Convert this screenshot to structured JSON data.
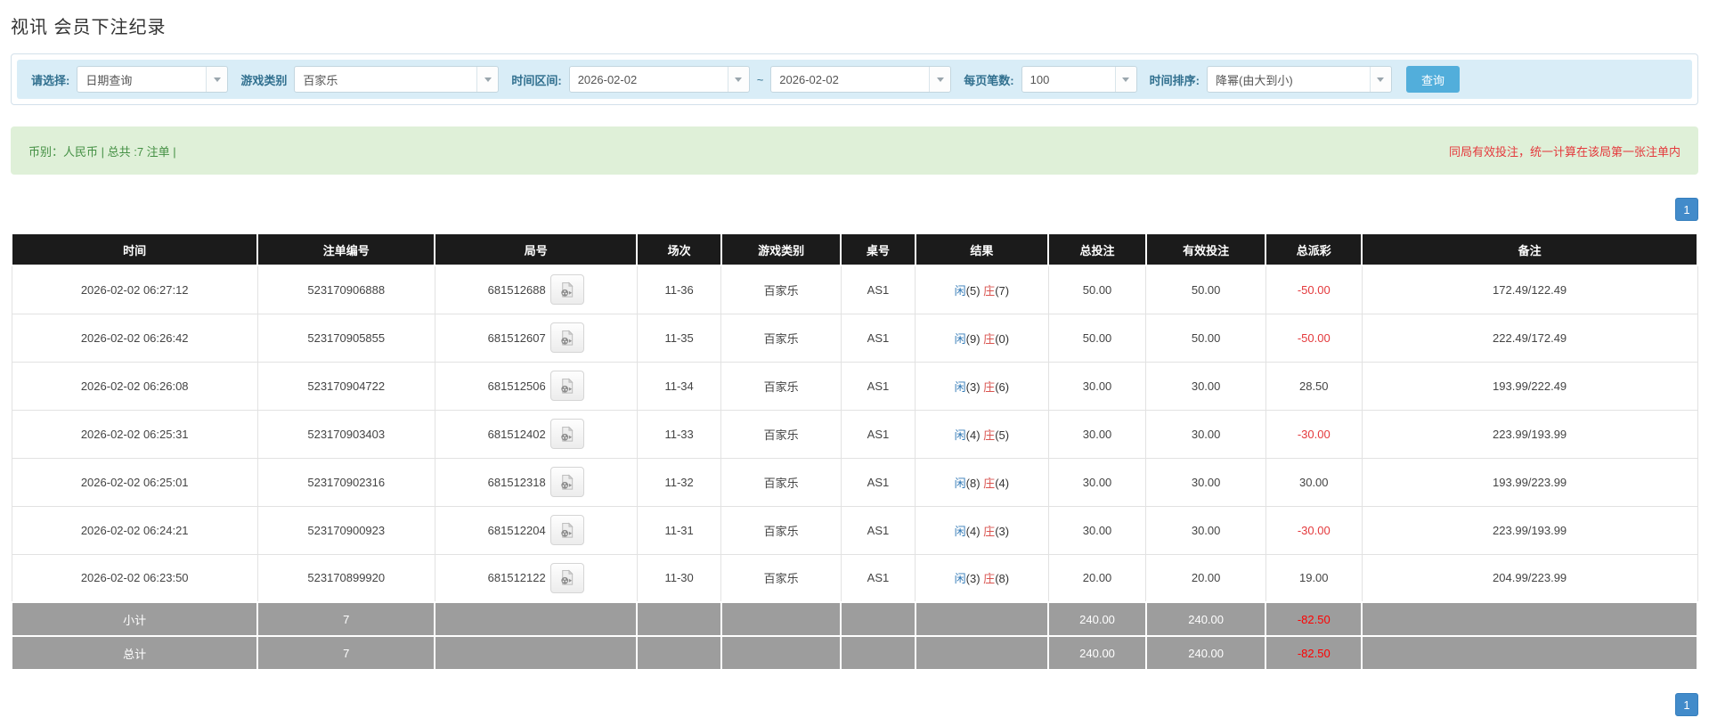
{
  "page": {
    "title": "视讯 会员下注纪录"
  },
  "filters": {
    "select_label": "请选择:",
    "select_value": "日期查询",
    "game_label": "游戏类别",
    "game_value": "百家乐",
    "range_label": "时间区间:",
    "date_from": "2026-02-02",
    "range_separator": "~",
    "date_to": "2026-02-02",
    "per_page_label": "每页笔数:",
    "per_page_value": "100",
    "sort_label": "时间排序:",
    "sort_value": "降幂(由大到小)",
    "query_button": "查询"
  },
  "summary": {
    "left_text": "币别：人民币 | 总共 :7 注单 |",
    "right_notice": "同局有效投注，统一计算在该局第一张注单内"
  },
  "pagination": {
    "page": "1"
  },
  "table": {
    "headers": [
      "时间",
      "注单编号",
      "局号",
      "场次",
      "游戏类别",
      "桌号",
      "结果",
      "总投注",
      "有效投注",
      "总派彩",
      "备注"
    ],
    "rows": [
      {
        "time": "2026-02-02 06:27:12",
        "bet_no": "523170906888",
        "round_no": "681512688",
        "session": "11-36",
        "game": "百家乐",
        "table_no": "AS1",
        "player_label": "闲",
        "player_score": "(5)",
        "banker_label": "庄",
        "banker_score": "(7)",
        "total_bet": "50.00",
        "valid_bet": "50.00",
        "payout": "-50.00",
        "note": "172.49/122.49"
      },
      {
        "time": "2026-02-02 06:26:42",
        "bet_no": "523170905855",
        "round_no": "681512607",
        "session": "11-35",
        "game": "百家乐",
        "table_no": "AS1",
        "player_label": "闲",
        "player_score": "(9)",
        "banker_label": "庄",
        "banker_score": "(0)",
        "total_bet": "50.00",
        "valid_bet": "50.00",
        "payout": "-50.00",
        "note": "222.49/172.49"
      },
      {
        "time": "2026-02-02 06:26:08",
        "bet_no": "523170904722",
        "round_no": "681512506",
        "session": "11-34",
        "game": "百家乐",
        "table_no": "AS1",
        "player_label": "闲",
        "player_score": "(3)",
        "banker_label": "庄",
        "banker_score": "(6)",
        "total_bet": "30.00",
        "valid_bet": "30.00",
        "payout": "28.50",
        "note": "193.99/222.49"
      },
      {
        "time": "2026-02-02 06:25:31",
        "bet_no": "523170903403",
        "round_no": "681512402",
        "session": "11-33",
        "game": "百家乐",
        "table_no": "AS1",
        "player_label": "闲",
        "player_score": "(4)",
        "banker_label": "庄",
        "banker_score": "(5)",
        "total_bet": "30.00",
        "valid_bet": "30.00",
        "payout": "-30.00",
        "note": "223.99/193.99"
      },
      {
        "time": "2026-02-02 06:25:01",
        "bet_no": "523170902316",
        "round_no": "681512318",
        "session": "11-32",
        "game": "百家乐",
        "table_no": "AS1",
        "player_label": "闲",
        "player_score": "(8)",
        "banker_label": "庄",
        "banker_score": "(4)",
        "total_bet": "30.00",
        "valid_bet": "30.00",
        "payout": "30.00",
        "note": "193.99/223.99"
      },
      {
        "time": "2026-02-02 06:24:21",
        "bet_no": "523170900923",
        "round_no": "681512204",
        "session": "11-31",
        "game": "百家乐",
        "table_no": "AS1",
        "player_label": "闲",
        "player_score": "(4)",
        "banker_label": "庄",
        "banker_score": "(3)",
        "total_bet": "30.00",
        "valid_bet": "30.00",
        "payout": "-30.00",
        "note": "223.99/193.99"
      },
      {
        "time": "2026-02-02 06:23:50",
        "bet_no": "523170899920",
        "round_no": "681512122",
        "session": "11-30",
        "game": "百家乐",
        "table_no": "AS1",
        "player_label": "闲",
        "player_score": "(3)",
        "banker_label": "庄",
        "banker_score": "(8)",
        "total_bet": "20.00",
        "valid_bet": "20.00",
        "payout": "19.00",
        "note": "204.99/223.99"
      }
    ],
    "subtotal": {
      "label": "小计",
      "count": "7",
      "total_bet": "240.00",
      "valid_bet": "240.00",
      "payout": "-82.50"
    },
    "total": {
      "label": "总计",
      "count": "7",
      "total_bet": "240.00",
      "valid_bet": "240.00",
      "payout": "-82.50"
    }
  },
  "colors": {
    "filter_bar_bg": "#d9edf7",
    "filter_label": "#31708f",
    "query_button": "#52aedb",
    "summary_bg": "#dff0d8",
    "summary_text_green": "#449044",
    "notice_red": "#e4393c",
    "pagination_blue": "#428bca",
    "header_bg": "#1b1b1b",
    "sum_row_bg": "#9d9d9d",
    "player_blue": "#337ab7",
    "banker_red": "#d9534f",
    "total_bet_blue": "#337ab7",
    "negative_red": "#e4393c"
  }
}
